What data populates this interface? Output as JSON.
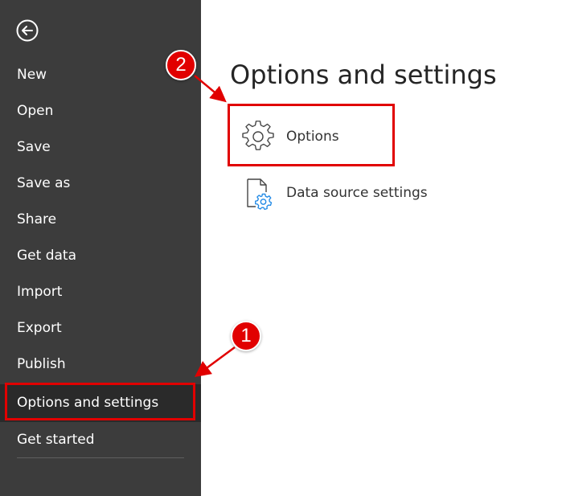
{
  "sidebar": {
    "items": [
      {
        "label": "New"
      },
      {
        "label": "Open"
      },
      {
        "label": "Save"
      },
      {
        "label": "Save as"
      },
      {
        "label": "Share"
      },
      {
        "label": "Get data"
      },
      {
        "label": "Import"
      },
      {
        "label": "Export"
      },
      {
        "label": "Publish"
      },
      {
        "label": "Options and settings",
        "selected": true
      },
      {
        "label": "Get started"
      }
    ],
    "background_color": "#3c3c3c",
    "selected_background_color": "#2a2a2a"
  },
  "main": {
    "title": "Options and settings",
    "options": [
      {
        "label": "Options",
        "icon": "gear-icon"
      },
      {
        "label": "Data source settings",
        "icon": "data-source-settings-icon"
      }
    ]
  },
  "annotations": {
    "badges": [
      {
        "number": "1",
        "target": "Options and settings"
      },
      {
        "number": "2",
        "target": "Options"
      }
    ],
    "highlight_color": "#e10000"
  }
}
